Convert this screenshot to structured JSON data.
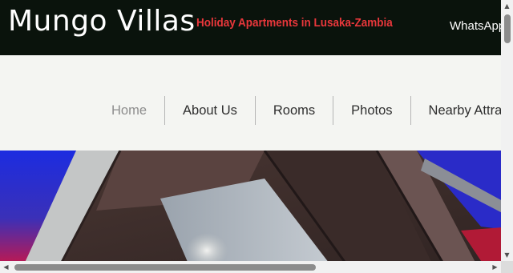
{
  "header": {
    "site_title": "Mungo Villas",
    "tagline": "Holiday Apartments in Lusaka-Zambia",
    "whatsapp_link": "WhatsApp"
  },
  "nav": {
    "items": [
      {
        "label": "Home",
        "active": true
      },
      {
        "label": "About Us",
        "active": false
      },
      {
        "label": "Rooms",
        "active": false
      },
      {
        "label": "Photos",
        "active": false
      },
      {
        "label": "Nearby Attractions",
        "active": false
      }
    ]
  },
  "hero": {
    "image_name": "apartment-ceiling-photo"
  },
  "scrollbars": {
    "up_icon": "triangle-up-icon",
    "down_icon": "triangle-down-icon",
    "left_icon": "triangle-left-icon",
    "right_icon": "triangle-right-icon"
  },
  "colors": {
    "header_bg": "#0a130c",
    "tagline_red": "#e9373b",
    "nav_bg": "#f4f5f2",
    "nav_text": "#2e2e2e",
    "nav_active_text": "#8d8d8d"
  }
}
